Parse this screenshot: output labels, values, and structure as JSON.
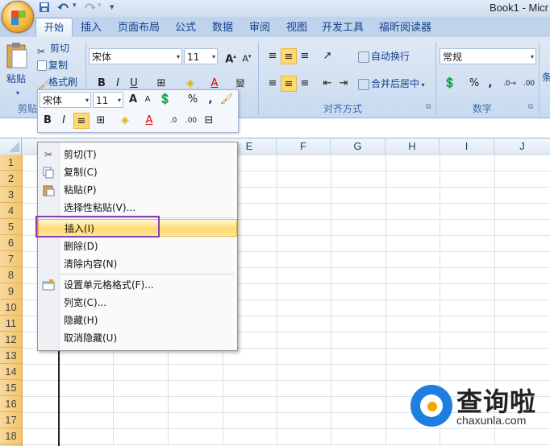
{
  "window": {
    "title": "Book1 - Micr"
  },
  "quick_access": {
    "save_icon": "save-icon",
    "undo_icon": "undo-icon",
    "redo_icon": "redo-icon",
    "customize": "▾"
  },
  "tabs": [
    {
      "label": "开始"
    },
    {
      "label": "插入"
    },
    {
      "label": "页面布局"
    },
    {
      "label": "公式"
    },
    {
      "label": "数据"
    },
    {
      "label": "审阅"
    },
    {
      "label": "视图"
    },
    {
      "label": "开发工具"
    },
    {
      "label": "福昕阅读器"
    }
  ],
  "ribbon": {
    "clipboard": {
      "paste": "粘贴",
      "cut": "剪切",
      "copy": "复制",
      "format_painter": "格式刷",
      "group_label": "剪贴"
    },
    "font": {
      "name": "宋体",
      "size": "11",
      "grow": "A",
      "shrink": "A"
    },
    "alignment": {
      "wrap_text": "自动换行",
      "merge_center": "合并后居中",
      "group_label": "对齐方式"
    },
    "number": {
      "format": "常规",
      "percent": "%",
      "comma": ",",
      "group_label": "数字"
    },
    "partial_right": "条"
  },
  "mini_toolbar": {
    "font": "宋体",
    "size": "11",
    "percent": "%",
    "comma": ",",
    "bold": "B",
    "italic": "I"
  },
  "columns": [
    "E",
    "F",
    "G",
    "H",
    "I",
    "J"
  ],
  "rows": [
    "1",
    "2",
    "3",
    "4",
    "5",
    "6",
    "7",
    "8",
    "9",
    "10",
    "11",
    "12",
    "13",
    "14",
    "15",
    "16",
    "17",
    "18"
  ],
  "context_menu": {
    "items": [
      {
        "label": "剪切(T)",
        "icon": "scissors-icon"
      },
      {
        "label": "复制(C)",
        "icon": "copy-icon"
      },
      {
        "label": "粘贴(P)",
        "icon": "paste-icon"
      },
      {
        "label": "选择性粘贴(V)..."
      },
      {
        "label": "插入(I)"
      },
      {
        "label": "删除(D)"
      },
      {
        "label": "清除内容(N)"
      },
      {
        "label": "设置单元格格式(F)...",
        "icon": "format-cells-icon"
      },
      {
        "label": "列宽(C)..."
      },
      {
        "label": "隐藏(H)"
      },
      {
        "label": "取消隐藏(U)"
      }
    ],
    "highlighted": "插入(I)"
  },
  "watermark": {
    "text": "查询啦",
    "url": "chaxunla.com"
  },
  "colors": {
    "accent": "#8a3fb0",
    "row_header_selected": "#f3c56a",
    "brand": "#1f7fe0"
  }
}
